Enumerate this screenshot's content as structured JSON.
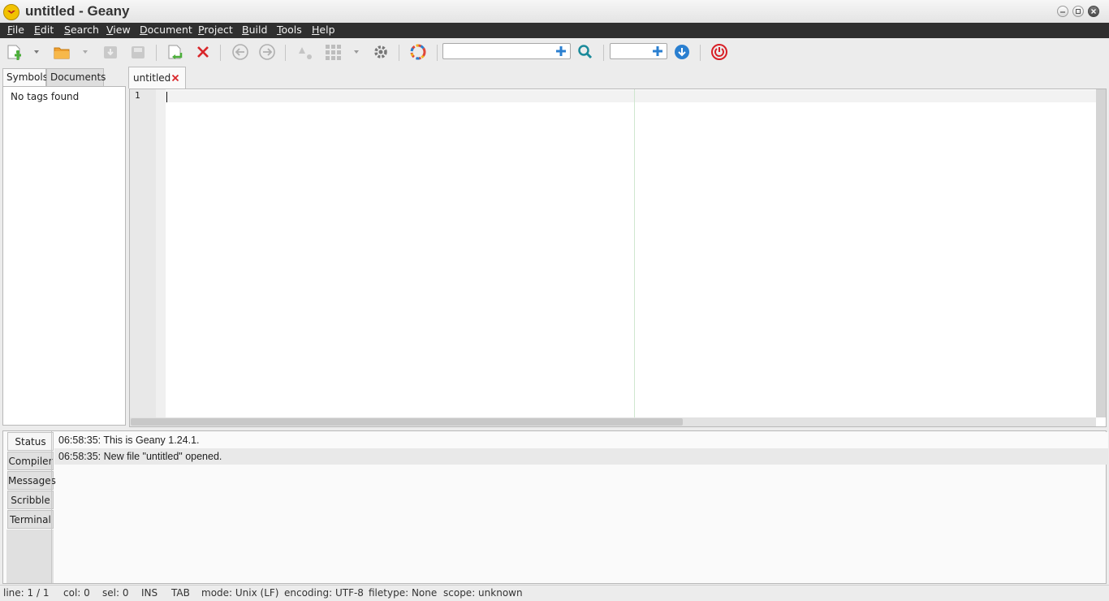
{
  "window": {
    "title": "untitled - Geany"
  },
  "menu": [
    "File",
    "Edit",
    "Search",
    "View",
    "Document",
    "Project",
    "Build",
    "Tools",
    "Help"
  ],
  "toolbar": {
    "icons": [
      "new-file-icon",
      "open-file-icon",
      "save-icon",
      "save-all-icon",
      "revert-icon",
      "close-icon",
      "back-icon",
      "forward-icon",
      "compile-icon",
      "build-icon",
      "run-icon",
      "color-chooser-icon",
      "search-icon",
      "goto-line-icon",
      "quit-icon"
    ],
    "search_value": "",
    "goto_value": ""
  },
  "sidebar": {
    "tabs": [
      "Symbols",
      "Documents"
    ],
    "active_tab": "Symbols",
    "empty_text": "No tags found"
  },
  "editor": {
    "tab_label": "untitled",
    "line_number": "1",
    "content": ""
  },
  "messages": {
    "tabs": [
      "Status",
      "Compiler",
      "Messages",
      "Scribble",
      "Terminal"
    ],
    "active_tab": "Status",
    "lines": [
      "06:58:35: This is Geany 1.24.1.",
      "06:58:35: New file \"untitled\" opened."
    ]
  },
  "statusbar": {
    "line": "line: 1 / 1",
    "col": "col: 0",
    "sel": "sel: 0",
    "ins": "INS",
    "tab": "TAB",
    "mode": "mode: Unix (LF)",
    "encoding": "encoding: UTF-8",
    "filetype": "filetype: None",
    "scope": "scope: unknown"
  },
  "colors": {
    "menubar_bg": "#2f2f2f",
    "close_tab_red": "#d9262a",
    "accent_green": "#4caf3a",
    "quit_red": "#d81f26",
    "search_teal": "#1a8a9a"
  }
}
